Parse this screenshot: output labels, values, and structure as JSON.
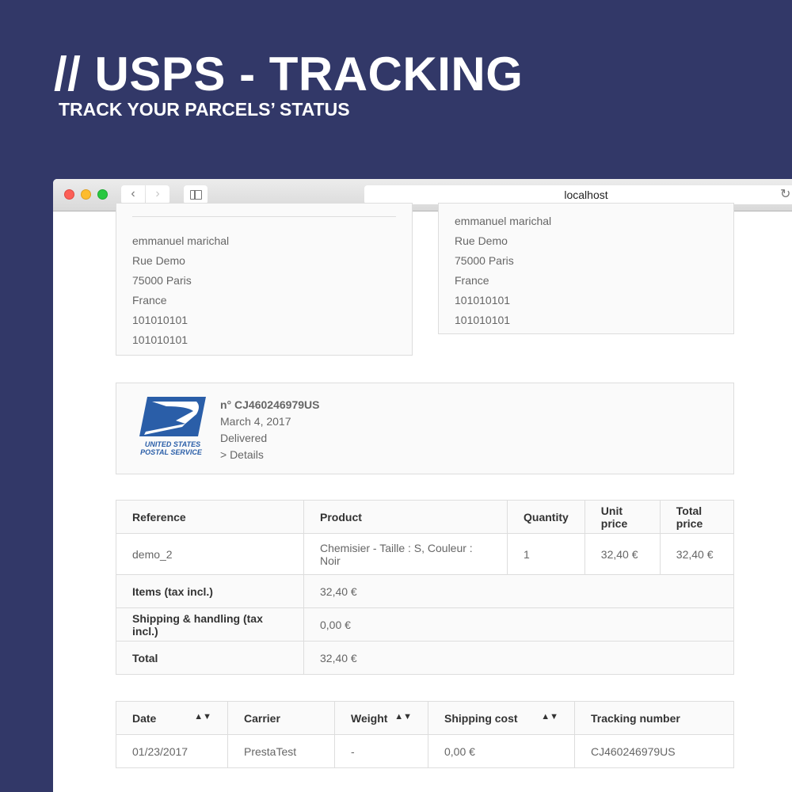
{
  "hero": {
    "title": "// USPS - TRACKING",
    "subtitle": "TRACK YOUR PARCELS’ STATUS"
  },
  "browser": {
    "url": "localhost",
    "back_label": "‹",
    "forward_label": "›",
    "reload_label": "↻"
  },
  "colors": {
    "background": "#323868",
    "usps_blue": "#2a5ea8"
  },
  "addresses": {
    "left": [
      "emmanuel marichal",
      "Rue Demo",
      "75000 Paris",
      "France",
      "101010101",
      "101010101"
    ],
    "right": [
      "emmanuel marichal",
      "Rue Demo",
      "75000 Paris",
      "France",
      "101010101",
      "101010101"
    ]
  },
  "tracking": {
    "logo_line1": "UNITED STATES",
    "logo_line2": "POSTAL SERVICE",
    "number": "n° CJ460246979US",
    "date": "March 4, 2017",
    "status": "Delivered",
    "details_link": "> Details"
  },
  "order_table": {
    "headers": [
      "Reference",
      "Product",
      "Quantity",
      "Unit price",
      "Total price"
    ],
    "rows": [
      [
        "demo_2",
        "Chemisier - Taille : S, Couleur : Noir",
        "1",
        "32,40 €",
        "32,40 €"
      ]
    ],
    "summary": [
      {
        "label": "Items (tax incl.)",
        "value": "32,40 €"
      },
      {
        "label": "Shipping & handling (tax incl.)",
        "value": "0,00 €"
      },
      {
        "label": "Total",
        "value": "32,40 €"
      }
    ]
  },
  "shipping_table": {
    "headers": [
      "Date",
      "Carrier",
      "Weight",
      "Shipping cost",
      "Tracking number"
    ],
    "sortable": [
      true,
      false,
      true,
      true,
      false
    ],
    "rows": [
      [
        "01/23/2017",
        "PrestaTest",
        "-",
        "0,00 €",
        "CJ460246979US"
      ]
    ]
  }
}
